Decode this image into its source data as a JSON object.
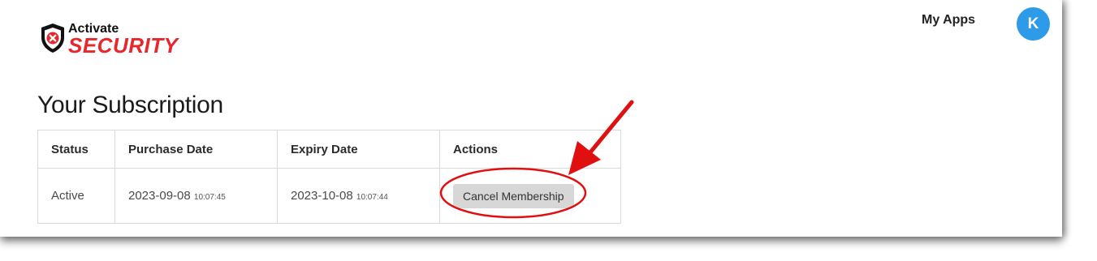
{
  "brand": {
    "word_top": "Activate",
    "word_bottom": "SECURITY",
    "colors": {
      "red": "#e8262b",
      "dark": "#111111"
    }
  },
  "header": {
    "nav_link": "My Apps",
    "avatar_initial": "K",
    "avatar_color": "#2d9be8"
  },
  "main": {
    "title": "Your Subscription",
    "table": {
      "columns": [
        "Status",
        "Purchase Date",
        "Expiry Date",
        "Actions"
      ],
      "rows": [
        {
          "status": "Active",
          "purchase_date": "2023-09-08",
          "purchase_time": "10:07:45",
          "expiry_date": "2023-10-08",
          "expiry_time": "10:07:44",
          "action_label": "Cancel Membership"
        }
      ]
    }
  },
  "annotation": {
    "type": "red arrow and ellipse highlighting cancel button",
    "color": "#e01010"
  }
}
